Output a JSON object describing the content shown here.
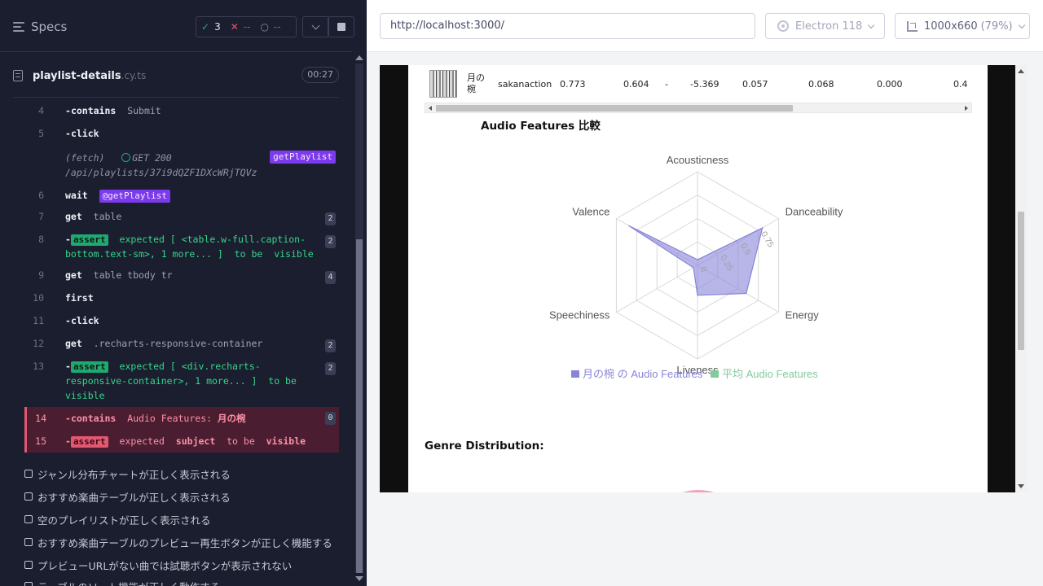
{
  "reporter": {
    "specs_label": "Specs",
    "stats": {
      "passed_icon": "✓",
      "passed": "3",
      "failed_icon": "✕",
      "failed": "--",
      "pending_icon": "○",
      "pending": "--"
    },
    "spec": {
      "name": "playlist-details",
      "ext": ".cy.ts",
      "duration": "00:27"
    },
    "commands": [
      {
        "num": "4",
        "prefix": "-",
        "name": "contains",
        "arg": "Submit"
      },
      {
        "num": "5",
        "prefix": "-",
        "name": "click"
      },
      {
        "fetch_label": "(fetch)",
        "method_status": "GET 200",
        "url": "/api/playlists/37i9dQZF1DXcWRjTQVz",
        "alias": "getPlaylist"
      },
      {
        "num": "6",
        "name": "wait",
        "alias": "@getPlaylist"
      },
      {
        "num": "7",
        "name": "get",
        "arg": "table",
        "count": "2"
      },
      {
        "num": "8",
        "prefix": "-",
        "badge": "assert",
        "line1": "expected [ <table.w-full.caption-",
        "line2": "bottom.text-sm>, 1 more... ]",
        "to_be": "to be",
        "state": "visible",
        "count": "2"
      },
      {
        "num": "9",
        "name": "get",
        "arg": "table tbody tr",
        "count": "4"
      },
      {
        "num": "10",
        "name": "first"
      },
      {
        "num": "11",
        "prefix": "-",
        "name": "click"
      },
      {
        "num": "12",
        "name": "get",
        "arg": ".recharts-responsive-container",
        "count": "2"
      },
      {
        "num": "13",
        "prefix": "-",
        "badge": "assert",
        "line1": "expected [ <div.recharts-",
        "line2": "responsive-container>, 1 more... ]",
        "to_be": "to be",
        "state": "visible",
        "count": "2"
      },
      {
        "num": "14",
        "prefix": "-",
        "name": "contains",
        "arg_a": "Audio Features:",
        "arg_b": "月の椀",
        "count": "0"
      },
      {
        "num": "15",
        "prefix": "-",
        "badge": "assert",
        "text_a": "expected",
        "text_b": "subject",
        "to_be": "to be",
        "state": "visible"
      }
    ],
    "tests": [
      "ジャンル分布チャートが正しく表示される",
      "おすすめ楽曲テーブルが正しく表示される",
      "空のプレイリストが正しく表示される",
      "おすすめ楽曲テーブルのプレビュー再生ボタンが正しく機能する",
      "プレビューURLがない曲では試聴ボタンが表示されない",
      "テーブルのソート機能が正しく動作する"
    ]
  },
  "aut_bar": {
    "url": "http://localhost:3000/",
    "browser": "Electron 118",
    "viewport": "1000x660",
    "viewport_display": "1000x660",
    "zoom": "(79%)"
  },
  "app": {
    "row": {
      "title_line1": "月の",
      "title_line2": "椀",
      "artist": "sakanaction",
      "v1": "0.773",
      "v2": "0.604",
      "v3": "-",
      "v4": "-5.369",
      "v5": "0.057",
      "v6": "0.068",
      "v7": "0.000",
      "v8": "0.4"
    },
    "audio_features_title": "Audio Features 比較",
    "genre_title": "Genre Distribution:"
  },
  "chart_data": {
    "type": "radar",
    "axes": [
      "Acousticness",
      "Danceability",
      "Energy",
      "Liveness",
      "Speechiness",
      "Valence"
    ],
    "radial_ticks": [
      "0",
      "0.25",
      "0.5",
      "0.75"
    ],
    "rmax": 1.0,
    "series": [
      {
        "name": "月の椀 の Audio Features",
        "color": "#8884d8",
        "values": [
          0.06,
          0.8,
          0.6,
          0.32,
          0.05,
          0.85
        ]
      },
      {
        "name": "平均 Audio Features",
        "color": "#82ca9d",
        "values": [
          0,
          0,
          0,
          0,
          0,
          0
        ]
      }
    ]
  }
}
